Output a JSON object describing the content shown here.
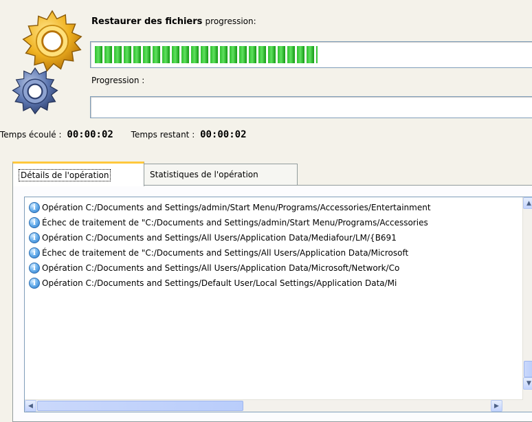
{
  "header": {
    "title_bold": "Restaurer des fichiers",
    "title_rest": "progression:",
    "main_progress_fraction": 0.5,
    "progress_label": "Progression :",
    "sub_progress_fraction": 0.0
  },
  "times": {
    "elapsed_label": "Temps écoulé :",
    "elapsed_value": "00:00:02",
    "remaining_label": "Temps restant :",
    "remaining_value": "00:00:02"
  },
  "tabs": [
    {
      "label": "Détails de l'opération",
      "active": true
    },
    {
      "label": "Statistiques de l'opération",
      "active": false
    }
  ],
  "log": [
    {
      "icon": "info-icon",
      "text": "Opération C:/Documents and Settings/admin/Start Menu/Programs/Accessories/Entertainment"
    },
    {
      "icon": "info-icon",
      "text": "Échec de traitement de \"C:/Documents and Settings/admin/Start Menu/Programs/Accessories"
    },
    {
      "icon": "info-icon",
      "text": "Opération C:/Documents and Settings/All Users/Application Data/Mediafour/LM/{B691"
    },
    {
      "icon": "info-icon",
      "text": "Échec de traitement de \"C:/Documents and Settings/All Users/Application Data/Microsoft"
    },
    {
      "icon": "info-icon",
      "text": "Opération C:/Documents and Settings/All Users/Application Data/Microsoft/Network/Co"
    },
    {
      "icon": "info-icon",
      "text": "Opération C:/Documents and Settings/Default User/Local Settings/Application Data/Mi"
    }
  ],
  "colors": {
    "progress_green": "#2fbf2f",
    "active_tab_accent": "#ffc83c",
    "border_blue": "#7f9db9"
  }
}
